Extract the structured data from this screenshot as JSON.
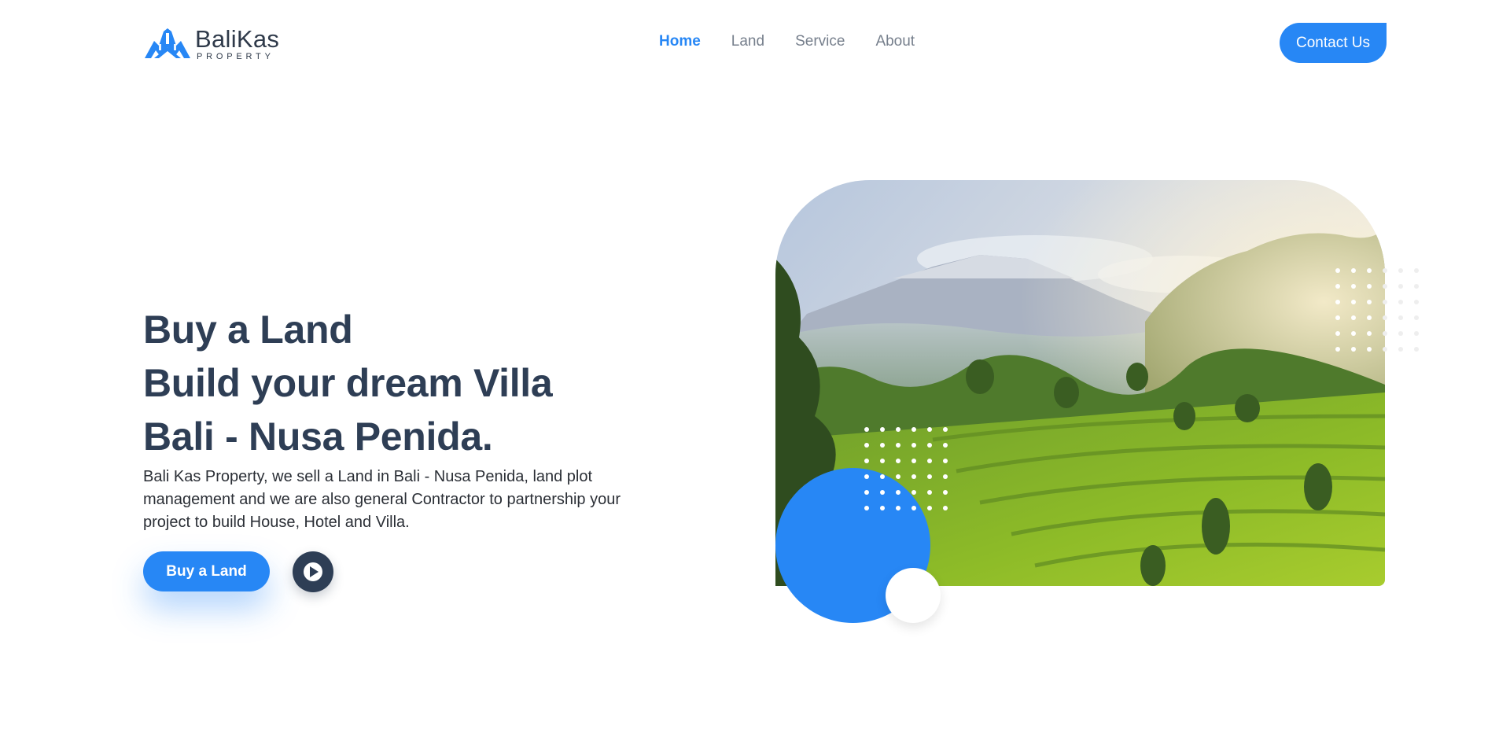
{
  "header": {
    "logo": {
      "name": "BaliKas",
      "sub": "PROPERTY",
      "icon": "house-roof-icon"
    },
    "nav": [
      {
        "label": "Home",
        "active": true
      },
      {
        "label": "Land",
        "active": false
      },
      {
        "label": "Service",
        "active": false
      },
      {
        "label": "About",
        "active": false
      }
    ],
    "contact_label": "Contact Us"
  },
  "hero": {
    "title_lines": [
      "Buy a Land",
      "Build your dream Villa",
      "Bali - Nusa Penida."
    ],
    "description": "Bali Kas Property, we sell a Land in Bali - Nusa Penida, land plot management and we are also general Contractor to partnership your project to build House, Hotel and Villa.",
    "buy_label": "Buy a Land",
    "play_icon": "play-icon",
    "image": "rice-terrace-mountain-photo"
  },
  "colors": {
    "accent": "#2787f5",
    "heading": "#2e3e55",
    "nav_text": "#767f8c"
  }
}
